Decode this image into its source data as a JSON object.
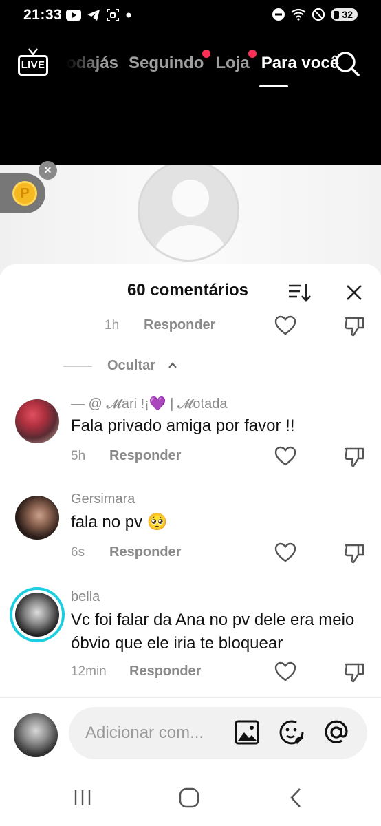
{
  "status_bar": {
    "time": "21:33",
    "battery": "32",
    "left_icons": [
      "youtube-icon",
      "telegram-icon",
      "screenshot-icon",
      "dot-icon"
    ],
    "right_icons": [
      "do-not-disturb-icon",
      "wifi-icon",
      "blocked-icon",
      "battery-icon"
    ]
  },
  "top_nav": {
    "live_label": "LIVE",
    "tabs": [
      {
        "label": "odajás",
        "has_dot": false
      },
      {
        "label": "Seguindo",
        "has_dot": true
      },
      {
        "label": "Loja",
        "has_dot": true
      },
      {
        "label": "Para você",
        "has_dot": false,
        "active": true
      }
    ]
  },
  "video": {
    "coin_symbol": "P"
  },
  "comments_sheet": {
    "title": "60 comentários",
    "top_meta": {
      "age": "1h",
      "reply_label": "Responder"
    },
    "hide_label": "Ocultar",
    "comments": [
      {
        "author": "— @ 𝓜ari !¡💜 | 𝓜otada",
        "text": "Fala privado amiga por favor !!",
        "age": "5h",
        "reply_label": "Responder"
      },
      {
        "author": "Gersimara",
        "text": "fala no pv 🥺",
        "age": "6s",
        "reply_label": "Responder"
      },
      {
        "author": "bella",
        "text": "Vc foi falar da Ana no pv dele era meio óbvio que ele iria te bloquear",
        "age": "12min",
        "reply_label": "Responder"
      }
    ]
  },
  "input_bar": {
    "placeholder": "Adicionar com..."
  },
  "colors": {
    "accent_dot": "#ff2f55",
    "story_ring": "#1ccfe0",
    "coin": "#f5b922"
  }
}
